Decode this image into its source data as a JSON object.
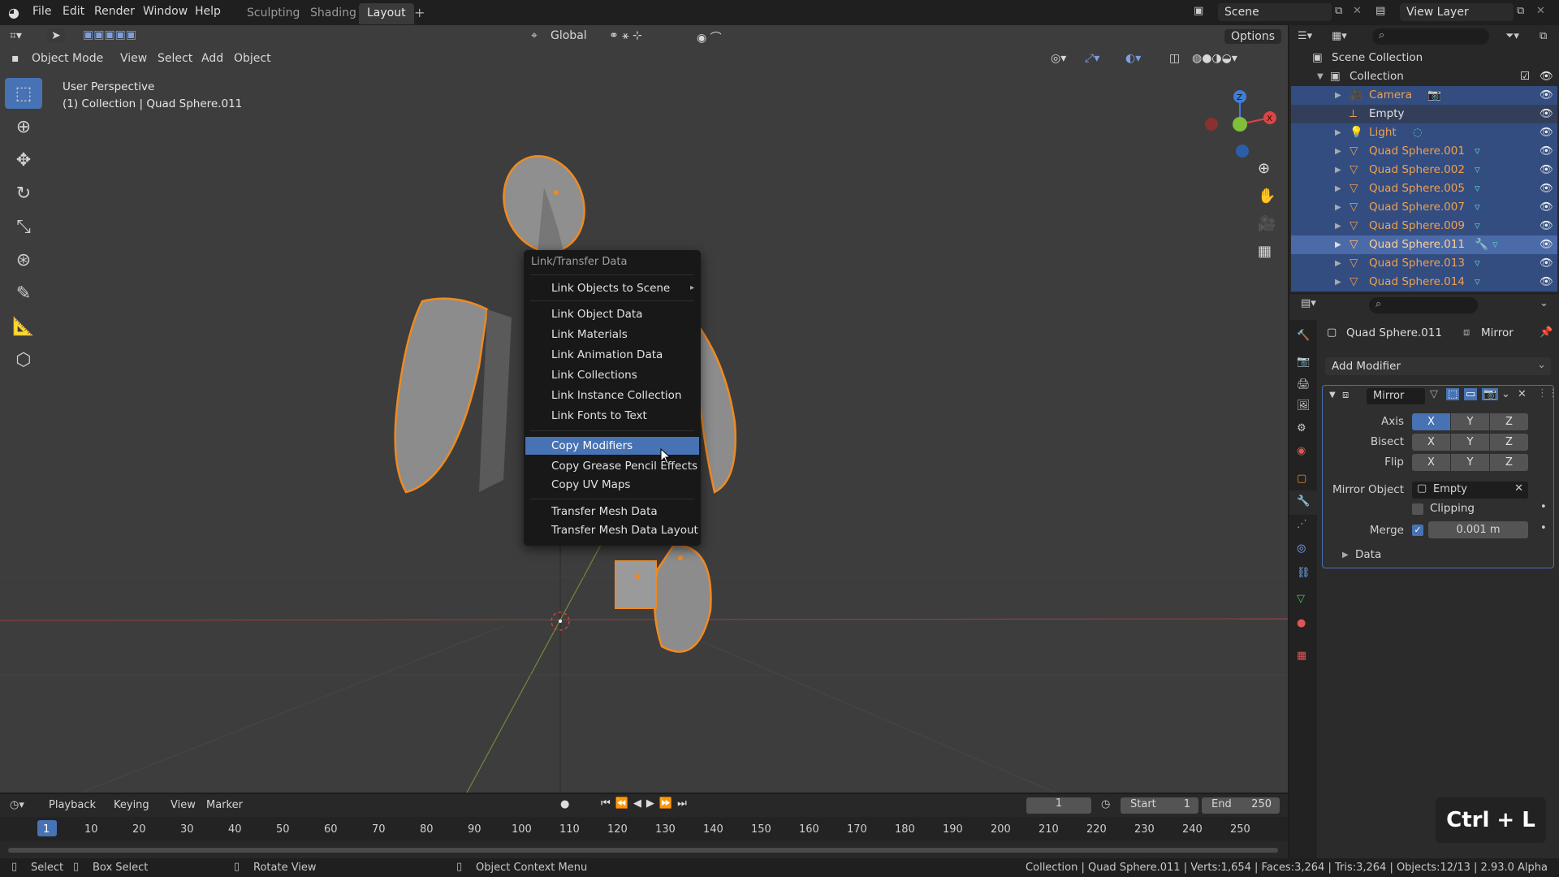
{
  "topbar": {
    "menus": [
      "File",
      "Edit",
      "Render",
      "Window",
      "Help"
    ],
    "tabs": [
      "Sculpting",
      "Shading",
      "Layout"
    ],
    "active_tab": "Layout",
    "scene": "Scene",
    "view_layer": "View Layer"
  },
  "viewport": {
    "mode": "Object Mode",
    "menus": [
      "View",
      "Select",
      "Add",
      "Object"
    ],
    "orientation": "Global",
    "options": "Options",
    "perspective": "User Perspective",
    "context_info": "(1) Collection | Quad Sphere.011"
  },
  "context_menu": {
    "title": "Link/Transfer Data",
    "items": [
      "Link Objects to Scene",
      "Link Object Data",
      "Link Materials",
      "Link Animation Data",
      "Link Collections",
      "Link Instance Collection",
      "Link Fonts to Text",
      "Copy Modifiers",
      "Copy Grease Pencil Effects",
      "Copy UV Maps",
      "Transfer Mesh Data",
      "Transfer Mesh Data Layout"
    ],
    "highlighted": "Copy Modifiers"
  },
  "outliner": {
    "root": "Scene Collection",
    "collection": "Collection",
    "items": [
      "Camera",
      "Empty",
      "Light",
      "Quad Sphere.001",
      "Quad Sphere.002",
      "Quad Sphere.005",
      "Quad Sphere.007",
      "Quad Sphere.009",
      "Quad Sphere.011",
      "Quad Sphere.013",
      "Quad Sphere.014"
    ]
  },
  "properties": {
    "object": "Quad Sphere.011",
    "modifier_crumb": "Mirror",
    "add_modifier": "Add Modifier",
    "modifier_name": "Mirror",
    "axis_label": "Axis",
    "bisect_label": "Bisect",
    "flip_label": "Flip",
    "axes": [
      "X",
      "Y",
      "Z"
    ],
    "mirror_object_label": "Mirror Object",
    "mirror_object": "Empty",
    "clipping": "Clipping",
    "merge_label": "Merge",
    "merge_value": "0.001 m",
    "data": "Data"
  },
  "timeline": {
    "menus": [
      "Playback",
      "Keying",
      "View",
      "Marker"
    ],
    "current_frame": "1",
    "start_label": "Start",
    "start": "1",
    "end_label": "End",
    "end": "250",
    "ticks": [
      "1",
      "10",
      "20",
      "30",
      "40",
      "50",
      "60",
      "70",
      "80",
      "90",
      "100",
      "110",
      "120",
      "130",
      "140",
      "150",
      "160",
      "170",
      "180",
      "190",
      "200",
      "210",
      "220",
      "230",
      "240",
      "250"
    ]
  },
  "statusbar": {
    "select": "Select",
    "box_select": "Box Select",
    "rotate": "Rotate View",
    "context": "Object Context Menu",
    "stats": "Collection | Quad Sphere.011 | Verts:1,654 | Faces:3,264 | Tris:3,264 | Objects:12/13 | 2.93.0 Alpha"
  },
  "shortcut": "Ctrl + L",
  "colors": {
    "accent": "#4772b3",
    "selection_orange": "#f0a050"
  }
}
